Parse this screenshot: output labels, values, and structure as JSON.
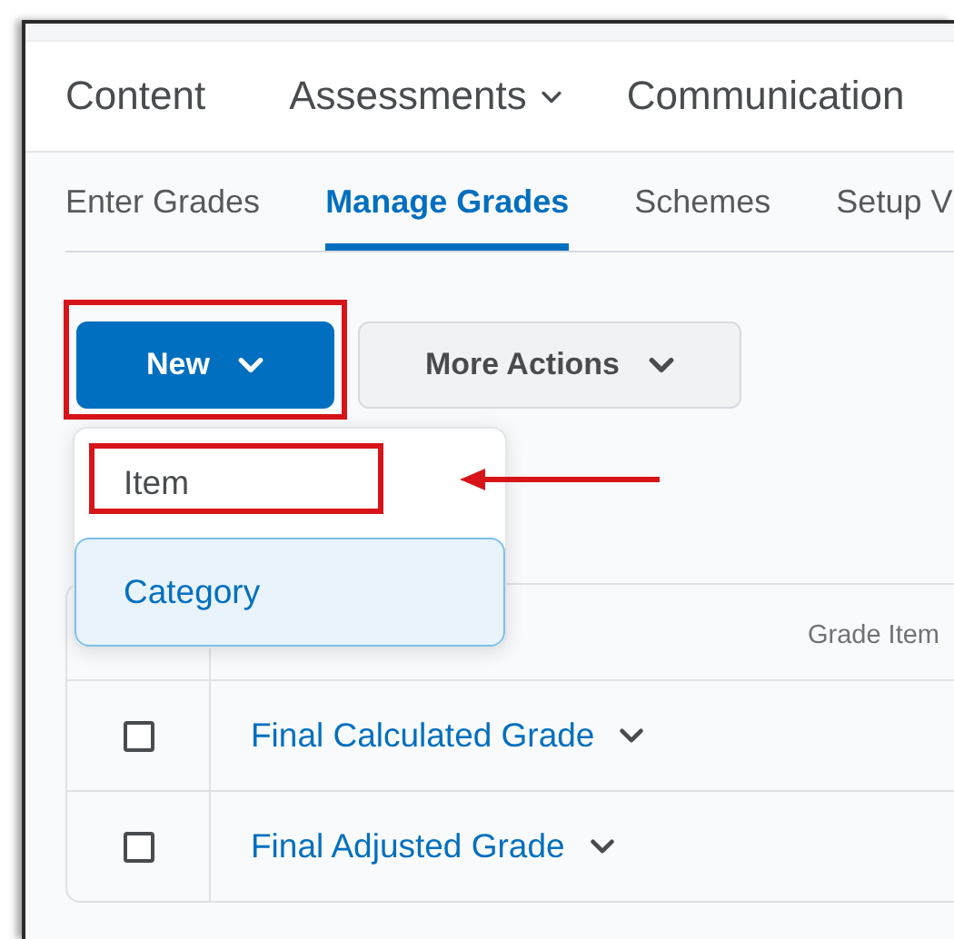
{
  "nav": {
    "items": [
      {
        "label": "Content",
        "has_menu": false
      },
      {
        "label": "Assessments",
        "has_menu": true
      },
      {
        "label": "Communication",
        "has_menu": false
      }
    ]
  },
  "subtabs": [
    {
      "label": "Enter Grades",
      "selected": false
    },
    {
      "label": "Manage Grades",
      "selected": true
    },
    {
      "label": "Schemes",
      "selected": false
    },
    {
      "label": "Setup V",
      "selected": false
    }
  ],
  "actions": [
    {
      "label": "New",
      "kind": "primary",
      "highlighted": true
    },
    {
      "label": "More Actions",
      "kind": "secondary",
      "highlighted": false
    }
  ],
  "new_menu": {
    "items": [
      {
        "label": "Item",
        "selected": false,
        "highlighted": true,
        "arrow": true
      },
      {
        "label": "Category",
        "selected": true,
        "highlighted": false,
        "arrow": false
      }
    ]
  },
  "table": {
    "columns": [
      "Grade Item"
    ],
    "rows": [
      {
        "name": "Final Calculated Grade",
        "checked": false
      },
      {
        "name": "Final Adjusted Grade",
        "checked": false
      }
    ]
  }
}
